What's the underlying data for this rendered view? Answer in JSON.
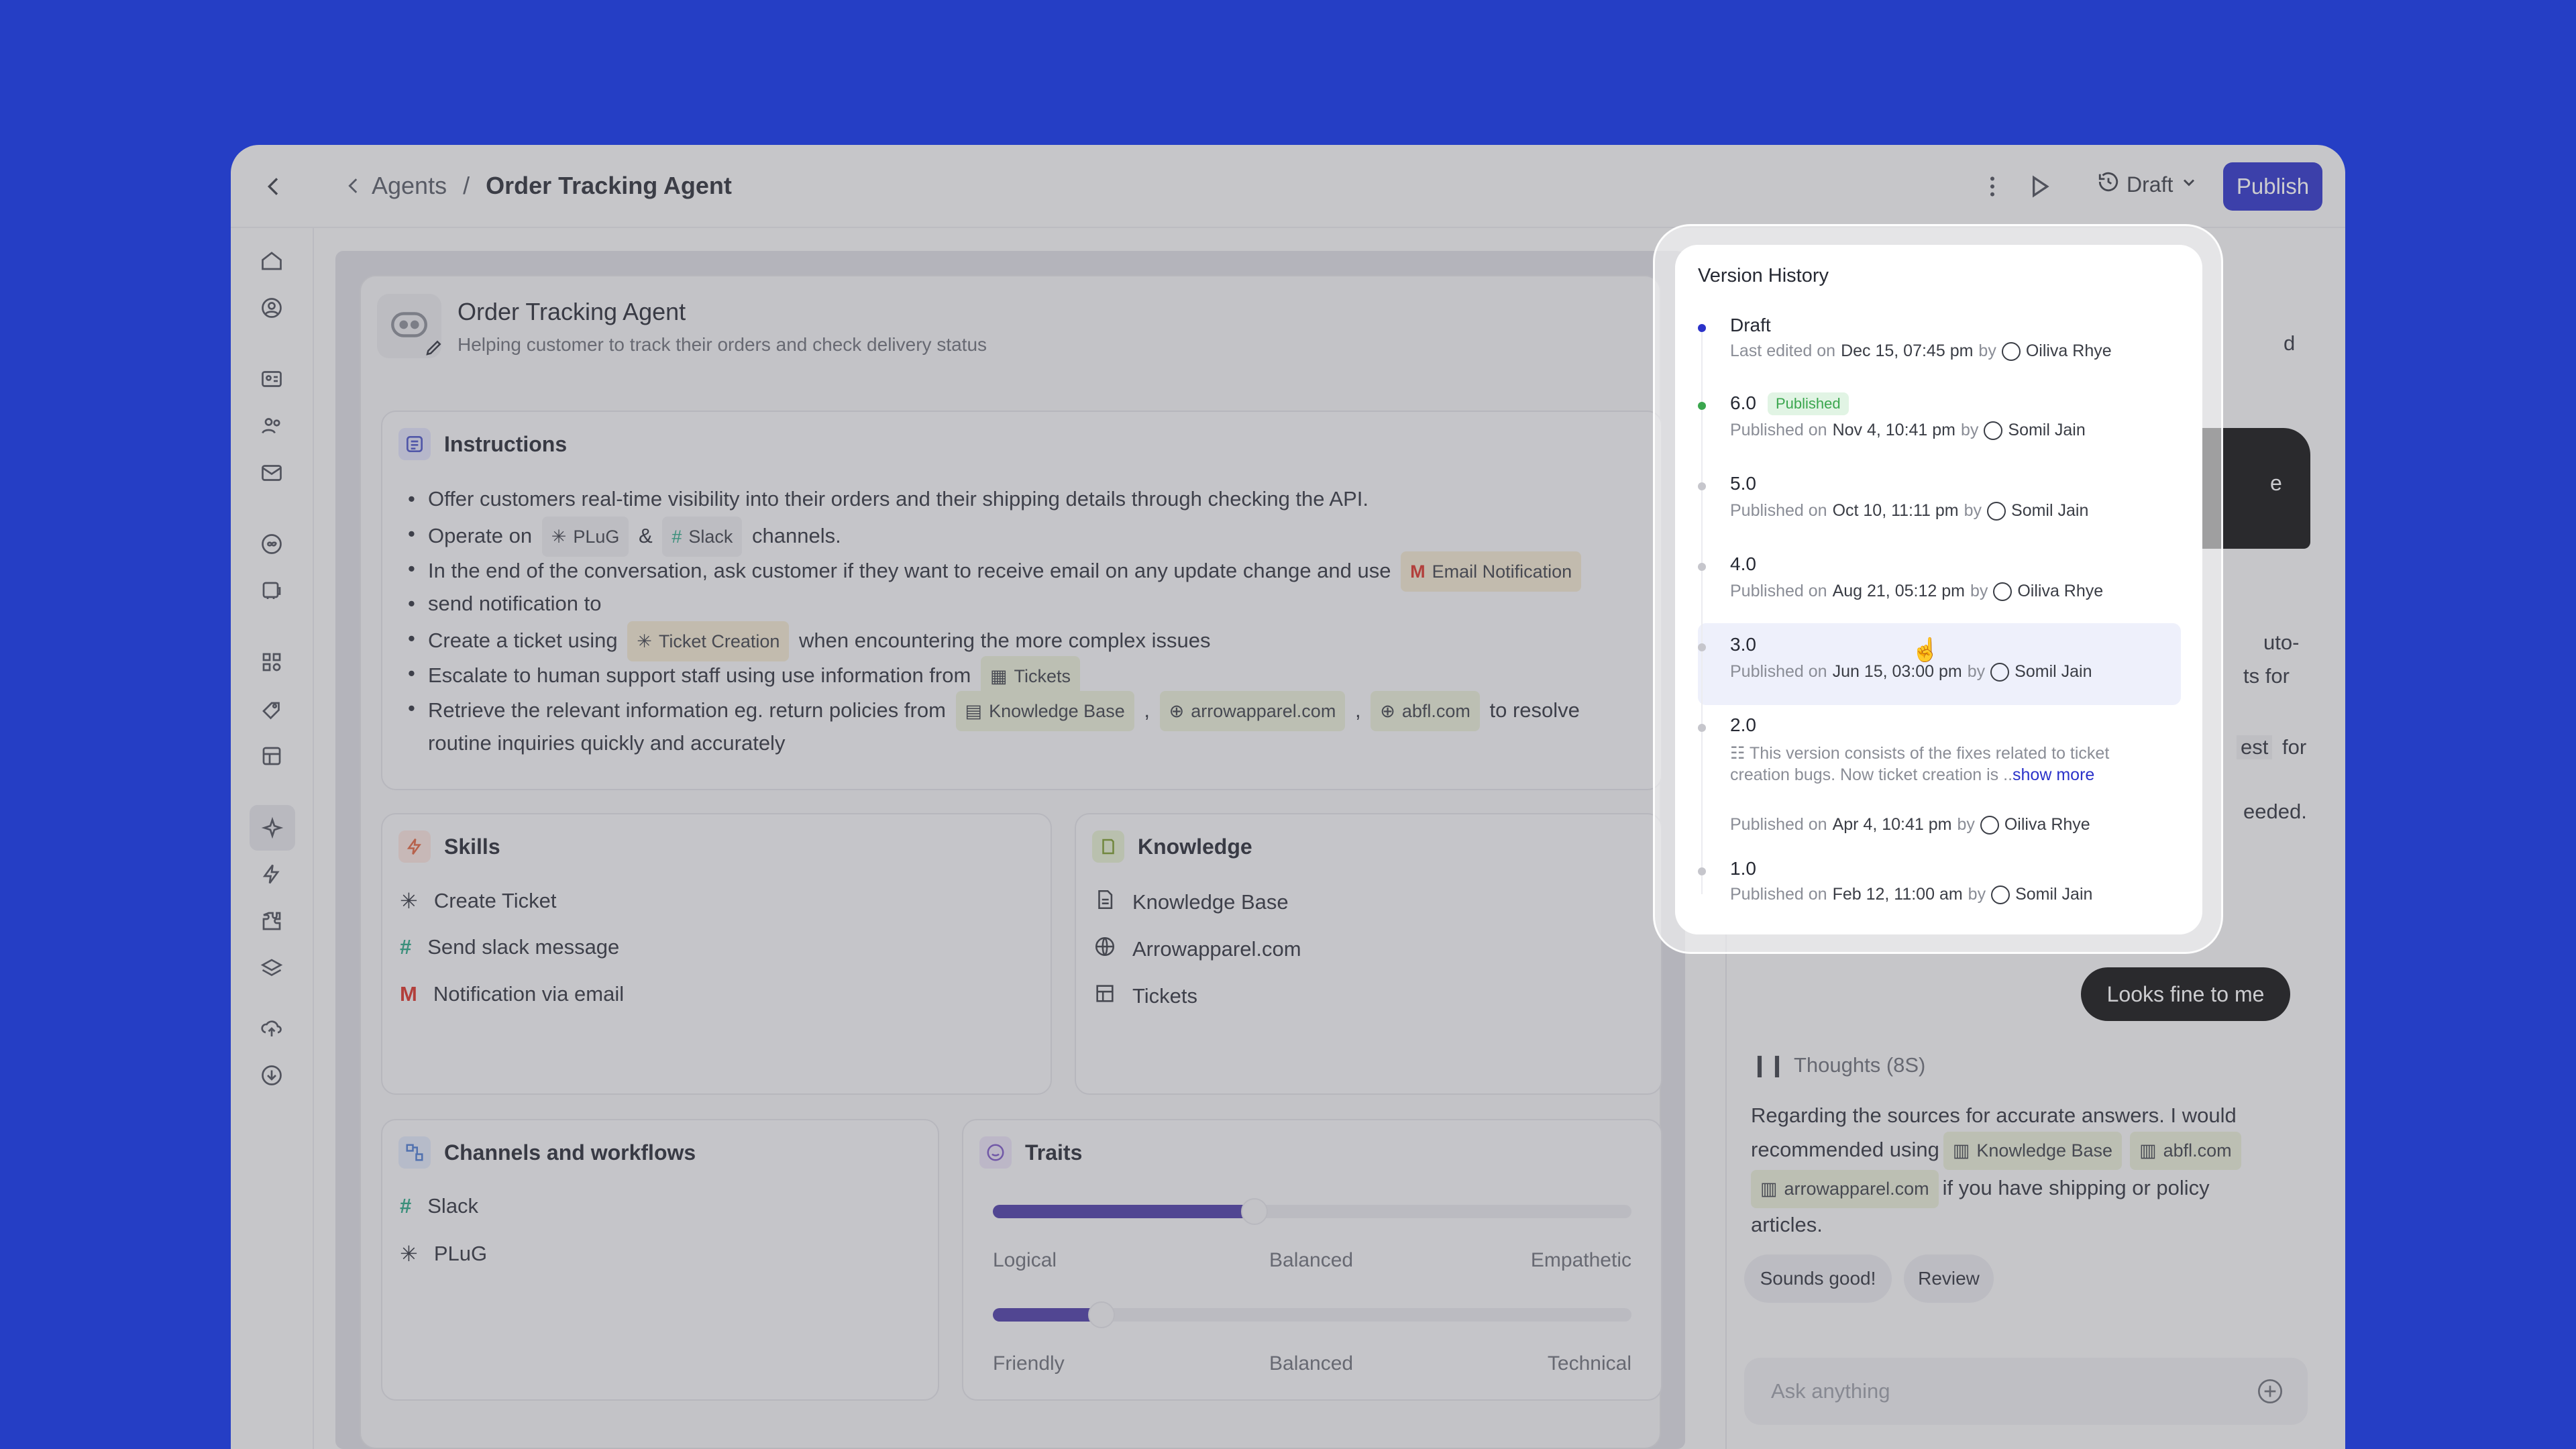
{
  "breadcrumb": {
    "parent": "Agents",
    "sep": "/",
    "current": "Order Tracking Agent"
  },
  "header": {
    "draft_label": "Draft",
    "publish_label": "Publish"
  },
  "agent": {
    "name": "Order Tracking Agent",
    "description": "Helping customer to track their orders and check delivery status"
  },
  "instructions": {
    "title": "Instructions",
    "l1": "Offer customers real-time visibility into their orders and their shipping details through checking the API.",
    "l2_a": "Operate on",
    "l2_plug": "PLuG",
    "l2_amp": "&",
    "l2_slack": "Slack",
    "l2_b": "channels.",
    "l3_a": "In the end of the conversation, ask customer if they want to receive email on any update change and use",
    "l3_chip": "Email Notification",
    "l3_b": "send notification to",
    "l4_a": "Create a ticket using",
    "l4_chip": "Ticket Creation",
    "l4_b": "when encountering the more complex issues",
    "l5_a": "Escalate to human support staff using use information from",
    "l5_chip": "Tickets",
    "l6_a": "Retrieve the relevant information eg. return policies from",
    "l6_c1": "Knowledge Base",
    "l6_comma": ",",
    "l6_c2": "arrowapparel.com",
    "l6_c3": "abfl.com",
    "l6_b": "to resolve",
    "l6_c": "routine inquiries quickly and accurately"
  },
  "skills": {
    "title": "Skills",
    "items": [
      "Create Ticket",
      "Send slack message",
      "Notification via email"
    ]
  },
  "knowledge": {
    "title": "Knowledge",
    "items": [
      "Knowledge Base",
      "Arrowapparel.com",
      "Tickets"
    ]
  },
  "channels": {
    "title": "Channels and workflows",
    "items": [
      "Slack",
      "PLuG"
    ]
  },
  "traits": {
    "title": "Traits",
    "slider1": {
      "left": "Logical",
      "mid": "Balanced",
      "right": "Empathetic",
      "value": 0.41
    },
    "slider2": {
      "left": "Friendly",
      "mid": "Balanced",
      "right": "Technical",
      "value": 0.17
    }
  },
  "chat": {
    "partial1": "d",
    "partial2": "e",
    "partial3": "uto-",
    "partial4": "ts for",
    "partial5": "est",
    "partial6": "for",
    "partial7": "eeded.",
    "user_msg": "Looks fine to me",
    "thoughts": "Thoughts (8S)",
    "reply_a": "Regarding the sources for accurate answers. I would",
    "reply_b": "recommended using",
    "chip1": "Knowledge Base",
    "chip2": "abfl.com",
    "chip3": "arrowapparel.com",
    "reply_c": "if you have shipping or policy",
    "reply_d": "articles.",
    "btn1": "Sounds good!",
    "btn2": "Review",
    "placeholder": "Ask anything"
  },
  "version_history": {
    "title": "Version History",
    "versions": [
      {
        "name": "Draft",
        "prefix": "Last edited on",
        "date": "Dec 15, 07:45 pm",
        "by": "by",
        "user": "Oiliva Rhye"
      },
      {
        "name": "6.0",
        "badge": "Published",
        "prefix": "Published on",
        "date": "Nov 4, 10:41 pm",
        "by": "by",
        "user": "Somil Jain"
      },
      {
        "name": "5.0",
        "prefix": "Published on",
        "date": "Oct 10, 11:11 pm",
        "by": "by",
        "user": "Somil Jain"
      },
      {
        "name": "4.0",
        "prefix": "Published on",
        "date": "Aug 21, 05:12 pm",
        "by": "by",
        "user": "Oiliva Rhye"
      },
      {
        "name": "3.0",
        "prefix": "Published on",
        "date": "Jun 15, 03:00 pm",
        "by": "by",
        "user": "Somil Jain"
      },
      {
        "name": "2.0",
        "note1": "This version consists of the fixes related to ticket",
        "note2": "creation bugs. Now ticket creation is ..",
        "show_more": "show more",
        "prefix": "Published on",
        "date": "Apr 4, 10:41 pm",
        "by": "by",
        "user": "Oiliva Rhye"
      },
      {
        "name": "1.0",
        "prefix": "Published on",
        "date": "Feb 12, 11:00 am",
        "by": "by",
        "user": "Somil Jain"
      }
    ]
  },
  "colors": {
    "background": "#0a2ff0",
    "publish": "#2b32c9",
    "draft_dot": "#2b32c9",
    "published_dot": "#3aa64e"
  }
}
